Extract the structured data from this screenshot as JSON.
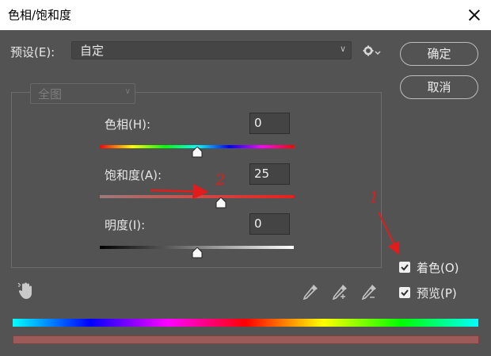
{
  "window": {
    "title": "色相/饱和度"
  },
  "preset": {
    "label": "预设(E):",
    "value": "自定"
  },
  "buttons": {
    "ok": "确定",
    "cancel": "取消"
  },
  "channel": {
    "value": "全图"
  },
  "sliders": [
    {
      "label": "色相(H):",
      "value": "0",
      "range": [
        -180,
        180
      ],
      "position": 0
    },
    {
      "label": "饱和度(A):",
      "value": "25",
      "range": [
        -100,
        100
      ],
      "position": 25
    },
    {
      "label": "明度(I):",
      "value": "0",
      "range": [
        -100,
        100
      ],
      "position": 0
    }
  ],
  "options": [
    {
      "label": "着色(O)",
      "checked": true
    },
    {
      "label": "预览(P)",
      "checked": true
    }
  ],
  "annotations": [
    {
      "text": "1"
    },
    {
      "text": "2"
    }
  ],
  "colors": {
    "dialog_bg": "#535353",
    "annotation": "#e11c1c",
    "result_bar": "#9c5a58"
  },
  "icons": [
    "gear-icon",
    "close-icon",
    "hand-adjust-icon",
    "eyedropper-icon",
    "eyedropper-add-icon",
    "eyedropper-subtract-icon"
  ]
}
